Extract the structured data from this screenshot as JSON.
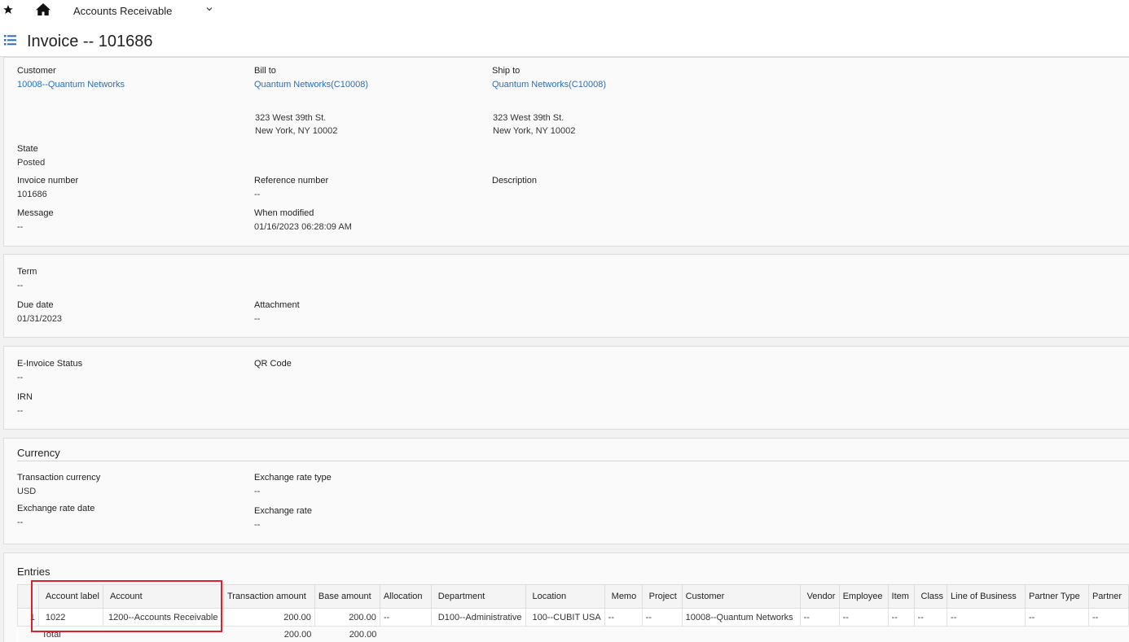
{
  "topbar": {
    "module": "Accounts Receivable",
    "icons": [
      "star-icon",
      "home-icon",
      "chevron-down-icon"
    ]
  },
  "header": {
    "title": "Invoice -- 101686",
    "icon": "list-icon"
  },
  "details": {
    "customer": {
      "label": "Customer",
      "value": "10008--Quantum Networks"
    },
    "bill_to": {
      "label": "Bill to",
      "value": "Quantum Networks(C10008)",
      "addr1": "323 West 39th St.",
      "addr2": "New York, NY 10002"
    },
    "ship_to": {
      "label": "Ship to",
      "value": "Quantum Networks(C10008)",
      "addr1": "323 West 39th St.",
      "addr2": "New York, NY 10002"
    },
    "state": {
      "label": "State",
      "value": "Posted"
    },
    "invoice_number": {
      "label": "Invoice number",
      "value": "101686"
    },
    "reference_number": {
      "label": "Reference number",
      "value": "--"
    },
    "description": {
      "label": "Description",
      "value": ""
    },
    "message": {
      "label": "Message",
      "value": "--"
    },
    "when_modified": {
      "label": "When modified",
      "value": "01/16/2023 06:28:09 AM"
    }
  },
  "terms": {
    "term": {
      "label": "Term",
      "value": "--"
    },
    "due_date": {
      "label": "Due date",
      "value": "01/31/2023"
    },
    "attachment": {
      "label": "Attachment",
      "value": "--"
    }
  },
  "einvoice": {
    "status": {
      "label": "E-Invoice Status",
      "value": "--"
    },
    "qr_code": {
      "label": "QR Code",
      "value": ""
    },
    "irn": {
      "label": "IRN",
      "value": "--"
    }
  },
  "currency": {
    "title": "Currency",
    "transaction_currency": {
      "label": "Transaction currency",
      "value": "USD"
    },
    "exchange_rate_type": {
      "label": "Exchange rate type",
      "value": "--"
    },
    "exchange_rate_date": {
      "label": "Exchange rate date",
      "value": "--"
    },
    "exchange_rate": {
      "label": "Exchange rate",
      "value": "--"
    }
  },
  "entries": {
    "title": "Entries",
    "columns": [
      "",
      "Account label",
      "Account",
      "Transaction amount",
      "Base amount",
      "Allocation",
      "Department",
      "Location",
      "Memo",
      "Project",
      "Customer",
      "Vendor",
      "Employee",
      "Item",
      "Class",
      "Line of Business",
      "Partner Type",
      "Partner"
    ],
    "rows": [
      [
        "1",
        "1022",
        "1200--Accounts Receivable",
        "200.00",
        "200.00",
        "--",
        "D100--Administrative",
        "100--CUBIT USA",
        "--",
        "--",
        "10008--Quantum Networks",
        "--",
        "--",
        "--",
        "--",
        "--",
        "--",
        "--"
      ]
    ],
    "total": {
      "label": "Total",
      "transaction_amount": "200.00",
      "base_amount": "200.00"
    }
  },
  "colors": {
    "link": "#2a6fb6",
    "highlight": "#d9232d",
    "background": "#f2f2f2"
  }
}
